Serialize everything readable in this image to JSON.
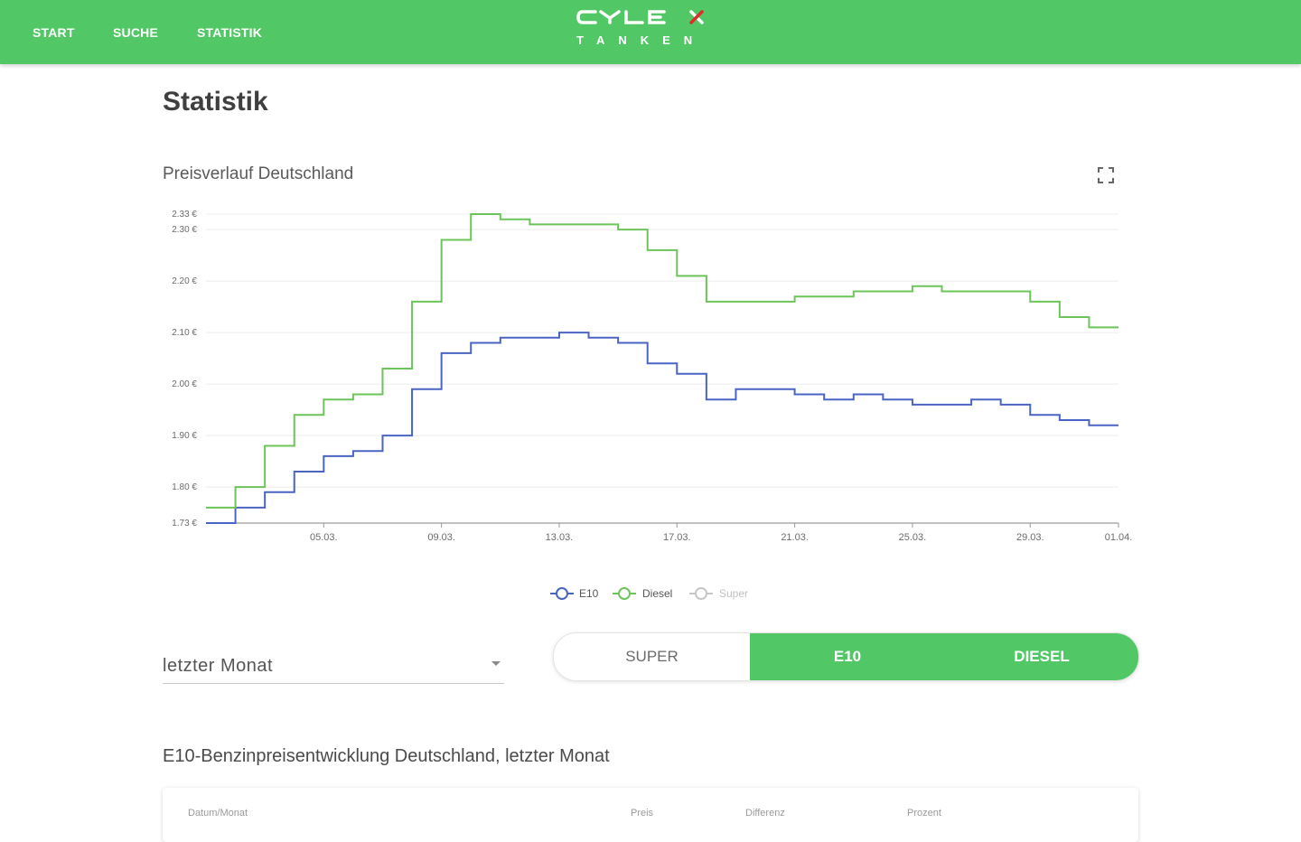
{
  "nav": {
    "items": [
      {
        "label": "START"
      },
      {
        "label": "SUCHE"
      },
      {
        "label": "STATISTIK"
      }
    ],
    "logo": {
      "brand": "CYLEX",
      "sub": "TANKEN"
    }
  },
  "page": {
    "title": "Statistik"
  },
  "chart": {
    "title": "Preisverlauf Deutschland"
  },
  "chart_data": {
    "type": "line",
    "step": true,
    "x_tick_labels": [
      "05.03.",
      "09.03.",
      "13.03.",
      "17.03.",
      "21.03.",
      "25.03.",
      "29.03.",
      "01.04."
    ],
    "y_tick_labels": [
      "2.33 €",
      "2.30 €",
      "2.20 €",
      "2.10 €",
      "2.00 €",
      "1.90 €",
      "1.80 €",
      "1.73 €"
    ],
    "ylim": [
      1.73,
      2.33
    ],
    "x": [
      "01.03.",
      "02.03.",
      "03.03.",
      "04.03.",
      "05.03.",
      "06.03.",
      "07.03.",
      "08.03.",
      "09.03.",
      "10.03.",
      "11.03.",
      "12.03.",
      "13.03.",
      "14.03.",
      "15.03.",
      "16.03.",
      "17.03.",
      "18.03.",
      "19.03.",
      "20.03.",
      "21.03.",
      "22.03.",
      "23.03.",
      "24.03.",
      "25.03.",
      "26.03.",
      "27.03.",
      "28.03.",
      "29.03.",
      "30.03.",
      "31.03.",
      "01.04."
    ],
    "series": [
      {
        "name": "E10",
        "color": "#4a64c4",
        "visible": true,
        "values": [
          1.73,
          1.76,
          1.79,
          1.83,
          1.86,
          1.87,
          1.9,
          1.99,
          2.06,
          2.08,
          2.09,
          2.09,
          2.1,
          2.09,
          2.08,
          2.04,
          2.02,
          1.97,
          1.99,
          1.99,
          1.98,
          1.97,
          1.98,
          1.97,
          1.96,
          1.96,
          1.97,
          1.96,
          1.94,
          1.93,
          1.92,
          1.92
        ]
      },
      {
        "name": "Diesel",
        "color": "#6cc45a",
        "visible": true,
        "values": [
          1.76,
          1.8,
          1.88,
          1.94,
          1.97,
          1.98,
          2.03,
          2.16,
          2.28,
          2.33,
          2.32,
          2.31,
          2.31,
          2.31,
          2.3,
          2.26,
          2.21,
          2.16,
          2.16,
          2.16,
          2.17,
          2.17,
          2.18,
          2.18,
          2.19,
          2.18,
          2.18,
          2.18,
          2.16,
          2.13,
          2.11,
          2.11
        ]
      },
      {
        "name": "Super",
        "color": "#bdbdbd",
        "visible": false,
        "values": []
      }
    ],
    "legend_position": "bottom-center",
    "grid": true
  },
  "controls": {
    "period": {
      "value": "letzter Monat"
    },
    "fuel_toggle": [
      {
        "label": "SUPER",
        "active": false
      },
      {
        "label": "E10",
        "active": true
      },
      {
        "label": "DIESEL",
        "active": true
      }
    ]
  },
  "section": {
    "title": "E10-Benzinpreisentwicklung Deutschland, letzter Monat"
  },
  "table": {
    "headers": [
      "Datum/Monat",
      "Preis",
      "Differenz",
      "Prozent"
    ]
  },
  "icons": {
    "fullscreen": "fullscreen-icon",
    "dropdown": "chevron-down-icon"
  },
  "colors": {
    "brand_green": "#52c765",
    "e10_blue": "#4a64c4",
    "diesel_green": "#6cc45a",
    "super_grey": "#bdbdbd"
  }
}
